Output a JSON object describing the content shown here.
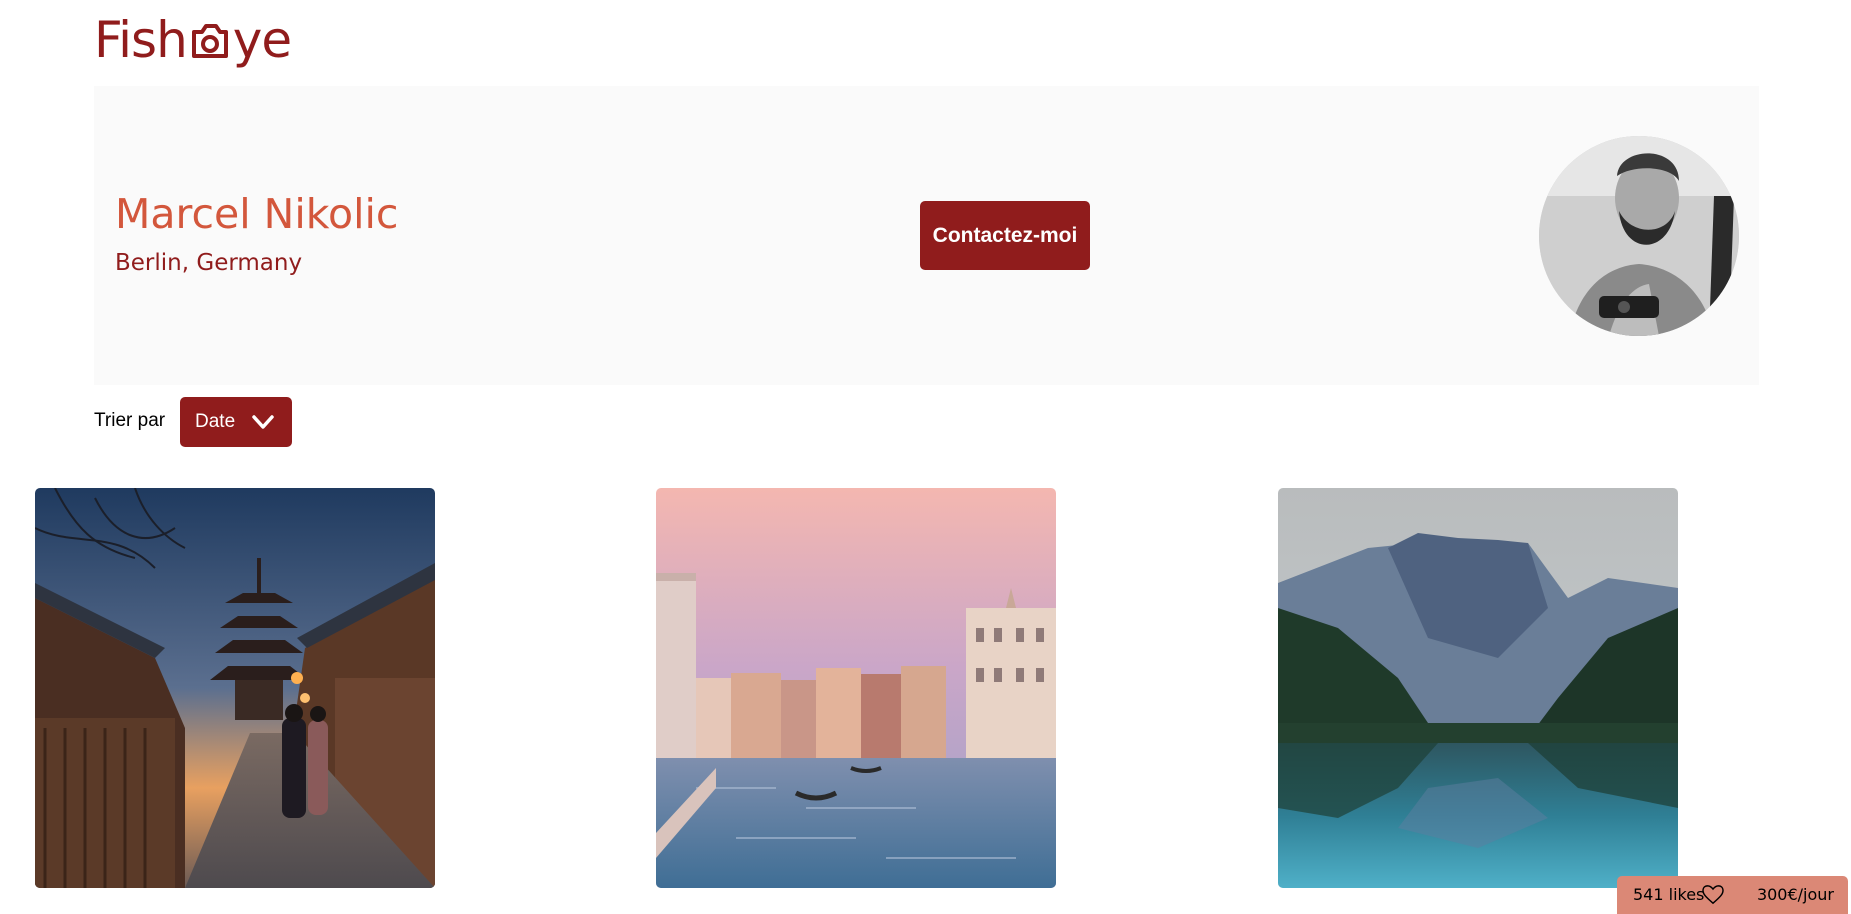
{
  "header": {
    "logo": {
      "text_before": "Fish",
      "text_after": "ye",
      "icon": "camera-icon",
      "color": "#901C1C"
    }
  },
  "photographer": {
    "name": "Marcel Nikolic",
    "location": "Berlin, Germany",
    "contact_label": "Contactez-moi",
    "avatar_alt": "Marcel Nikolic"
  },
  "sort": {
    "label": "Trier par",
    "selected": "Date",
    "icon": "chevron-down-icon"
  },
  "gallery": [
    {
      "alt": "Kyoto street with pagoda at sunset"
    },
    {
      "alt": "Venice grand canal"
    },
    {
      "alt": "Mountain lake reflection"
    }
  ],
  "stats": {
    "likes": "541 likes",
    "icon": "heart-icon",
    "price": "300€/jour"
  },
  "colors": {
    "primary": "#901C1C",
    "secondary": "#D3573C",
    "banner_bg": "#FAFAFA",
    "stats_bg": "#DB8876"
  }
}
